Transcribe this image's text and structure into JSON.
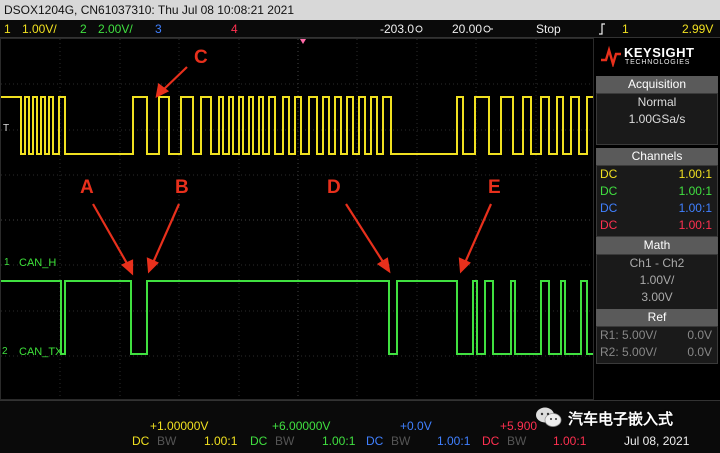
{
  "titlebar": {
    "text": "DSOX1204G, CN61037310: Thu Jul 08 10:08:21 2021"
  },
  "status": {
    "ch1_num": "1",
    "ch1_scale": "1.00V/",
    "ch2_num": "2",
    "ch2_scale": "2.00V/",
    "ch3_num": "3",
    "ch4_num": "4",
    "delay": "-203.0",
    "timebase": "20.00",
    "run_state": "Stop",
    "trigger_icon": "trigger-edge-icon",
    "trigger_ch": "1",
    "trigger_level": "2.99V"
  },
  "screen": {
    "trigger_marker": "T",
    "ch1_marker": "1",
    "ch2_marker": "2",
    "label_can_h": "CAN_H",
    "label_can_tx": "CAN_TX",
    "annotations": [
      "A",
      "B",
      "C",
      "D",
      "E"
    ]
  },
  "panel": {
    "brand": "KEYSIGHT",
    "brand_sub": "TECHNOLOGIES",
    "acquisition": {
      "header": "Acquisition",
      "mode": "Normal",
      "rate": "1.00GSa/s"
    },
    "channels": {
      "header": "Channels",
      "rows": [
        {
          "coupling": "DC",
          "probe": "1.00:1",
          "color": "#f0e020"
        },
        {
          "coupling": "DC",
          "probe": "1.00:1",
          "color": "#40e040"
        },
        {
          "coupling": "DC",
          "probe": "1.00:1",
          "color": "#4080ff"
        },
        {
          "coupling": "DC",
          "probe": "1.00:1",
          "color": "#ff3050"
        }
      ]
    },
    "math": {
      "header": "Math",
      "func": "Ch1 - Ch2",
      "scale": "1.00V/",
      "offset": "3.00V"
    },
    "ref": {
      "header": "Ref",
      "rows": [
        {
          "name": "R1:",
          "scale": "5.00V/",
          "offset": "0.0V"
        },
        {
          "name": "R2:",
          "scale": "5.00V/",
          "offset": "0.0V"
        }
      ]
    }
  },
  "bottom": {
    "offsets": [
      "+1.00000V",
      "+6.00000V",
      "+0.0V",
      "+5.900"
    ],
    "coupling": [
      "DC",
      "DC",
      "DC",
      "DC"
    ],
    "bw": [
      "BW",
      "BW",
      "BW",
      "BW"
    ],
    "probe": [
      "1.00:1",
      "1.00:1",
      "1.00:1",
      "1.00:1"
    ],
    "date": "Jul 08, 2021"
  },
  "watermark": {
    "text": "汽车电子嵌入式"
  },
  "colors": {
    "ch1": "#f0e020",
    "ch2": "#40e040",
    "ch3": "#4080ff",
    "ch4": "#ff3050",
    "annotation": "#e8301c"
  }
}
